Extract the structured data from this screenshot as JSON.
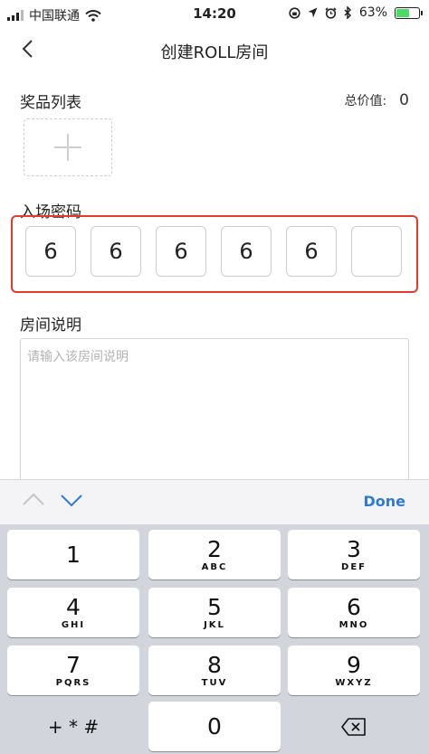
{
  "status_bar": {
    "carrier": "中国联通",
    "time": "14:20",
    "battery_percent": "63%",
    "battery_level": 0.63,
    "icons": [
      "signal-icon",
      "wifi-icon",
      "rotation-lock-icon",
      "location-icon",
      "alarm-icon",
      "bluetooth-icon",
      "battery-icon"
    ]
  },
  "nav": {
    "title": "创建ROLL房间",
    "back_icon": "chevron-left-icon"
  },
  "prizes": {
    "label": "奖品列表",
    "total_label": "总价值:",
    "total_value": "0",
    "add_icon": "plus-icon"
  },
  "password": {
    "label": "入场密码",
    "digits": [
      "6",
      "6",
      "6",
      "6",
      "6",
      ""
    ],
    "highlight_color": "#e33a2c"
  },
  "description": {
    "label": "房间说明",
    "placeholder": "请输入该房间说明"
  },
  "keyboard": {
    "done_label": "Done",
    "accent_color": "#2f7ad8",
    "keys": [
      {
        "num": "1",
        "letters": ""
      },
      {
        "num": "2",
        "letters": "ABC"
      },
      {
        "num": "3",
        "letters": "DEF"
      },
      {
        "num": "4",
        "letters": "GHI"
      },
      {
        "num": "5",
        "letters": "JKL"
      },
      {
        "num": "6",
        "letters": "MNO"
      },
      {
        "num": "7",
        "letters": "PQRS"
      },
      {
        "num": "8",
        "letters": "TUV"
      },
      {
        "num": "9",
        "letters": "WXYZ"
      }
    ],
    "symbols_label": "+ * #",
    "zero": "0",
    "delete_icon": "backspace-icon"
  }
}
